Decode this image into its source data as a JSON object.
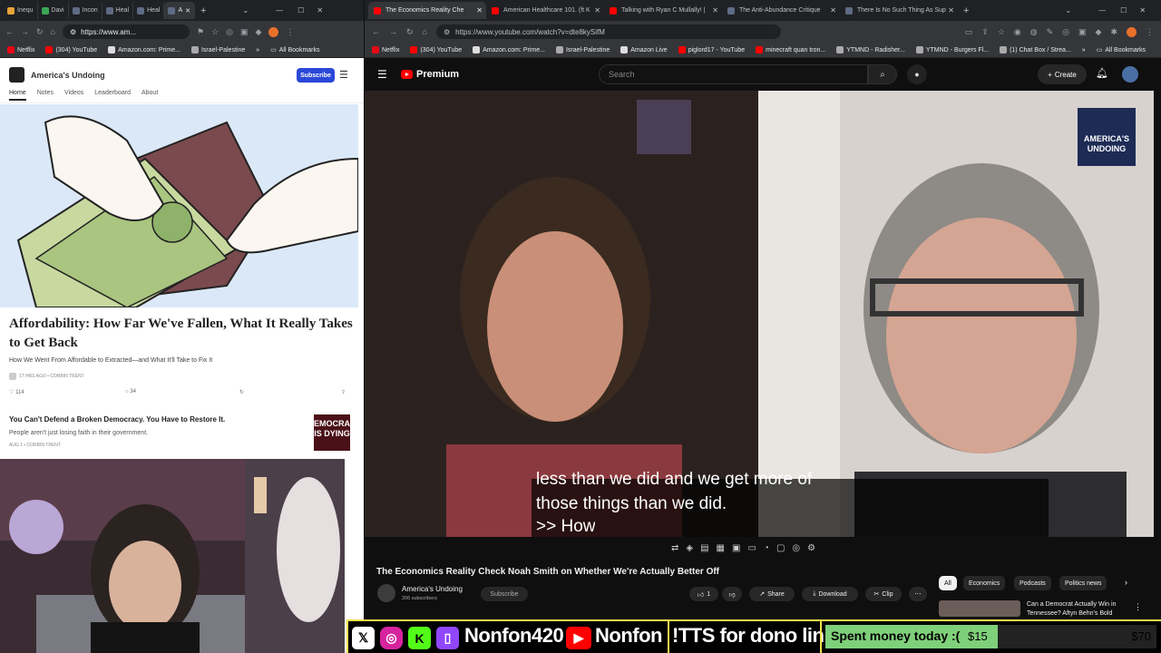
{
  "left_browser": {
    "tabs": [
      {
        "label": "Inequ",
        "color": "#e8a33a"
      },
      {
        "label": "Davi",
        "color": "#3aa757"
      },
      {
        "label": "Incon",
        "color": "#5f6b85"
      },
      {
        "label": "Heal",
        "color": "#5f6b85"
      },
      {
        "label": "Heal",
        "color": "#5f6b85"
      },
      {
        "label": "A",
        "color": "#5f6b85",
        "active": true
      }
    ],
    "url": "https://www.am...",
    "bookmarks": [
      "Netflix",
      "(304) YouTube",
      "Amazon.com: Prime...",
      "Israel-Palestine"
    ],
    "all_bookmarks": "All Bookmarks"
  },
  "substack": {
    "pub_name": "America's Undoing",
    "subscribe": "Subscribe",
    "nav": [
      "Home",
      "Notes",
      "Videos",
      "Leaderboard",
      "About"
    ],
    "featured": {
      "title": "Affordability: How Far We've Fallen, What It Really Takes to Get Back",
      "subtitle": "How We Went From Affordable to Extracted—and What It'll Take to Fix It",
      "meta": "17 HRS AGO • CORBIN TRENT",
      "likes": "114",
      "comments": "34"
    },
    "post2": {
      "title": "You Can't Defend a Broken Democracy. You Have to Restore It.",
      "subtitle": "People aren't just losing faith in their government.",
      "meta": "AUG 1 • CORBIN TRENT",
      "thumb_text": "EMOCRAC IS DYING"
    }
  },
  "right_browser": {
    "tabs": [
      {
        "label": "The Economics Reality Che",
        "color": "#ff0000",
        "active": true
      },
      {
        "label": "American Healthcare 101. (ft K",
        "color": "#ff0000"
      },
      {
        "label": "Talking with Ryan C Mullally! |",
        "color": "#ff0000"
      },
      {
        "label": "The Anti-Abundance Critique",
        "color": "#5f6b85"
      },
      {
        "label": "There Is No Such Thing As Sup",
        "color": "#5f6b85"
      }
    ],
    "url": "https://www.youtube.com/watch?v=dte8kySifM",
    "bookmarks": [
      "Netflix",
      "(304) YouTube",
      "Amazon.com: Prime...",
      "Israel-Palestine",
      "Amazon Live",
      "piglord17 - YouTube",
      "minecraft quan tron...",
      "YTMND - Radisher...",
      "YTMND - Burgers Fl...",
      "(1) Chat Box / Strea..."
    ],
    "all_bookmarks": "All Bookmarks"
  },
  "youtube": {
    "logo": "Premium",
    "search_placeholder": "Search",
    "create": "Create",
    "caption_line1": "less than we did and we get more of",
    "caption_line2": "those things than we did.",
    "caption_line3": ">> How",
    "watermark": "AMERICA'S UNDOING",
    "video_title": "The Economics Reality Check Noah Smith on Whether We're Actually Better Off",
    "channel": "America's Undoing",
    "subscribers": "206 subscribers",
    "subscribe": "Subscribe",
    "likes": "1",
    "share": "Share",
    "download": "Download",
    "clip": "Clip",
    "chips": [
      "All",
      "Economics",
      "Podcasts",
      "Politics news"
    ],
    "rec_title": "Can a Democrat Actually Win in Tennessee? Aftyn Behn's Bold"
  },
  "overlay": {
    "twitch_name": "Nonfon420",
    "youtube_name": "Nonfon",
    "tts": "!TTS for dono link",
    "goal_label": "Spent money today :(",
    "goal_current": "$15",
    "goal_target": "$70",
    "goal_fraction": 0.21
  }
}
